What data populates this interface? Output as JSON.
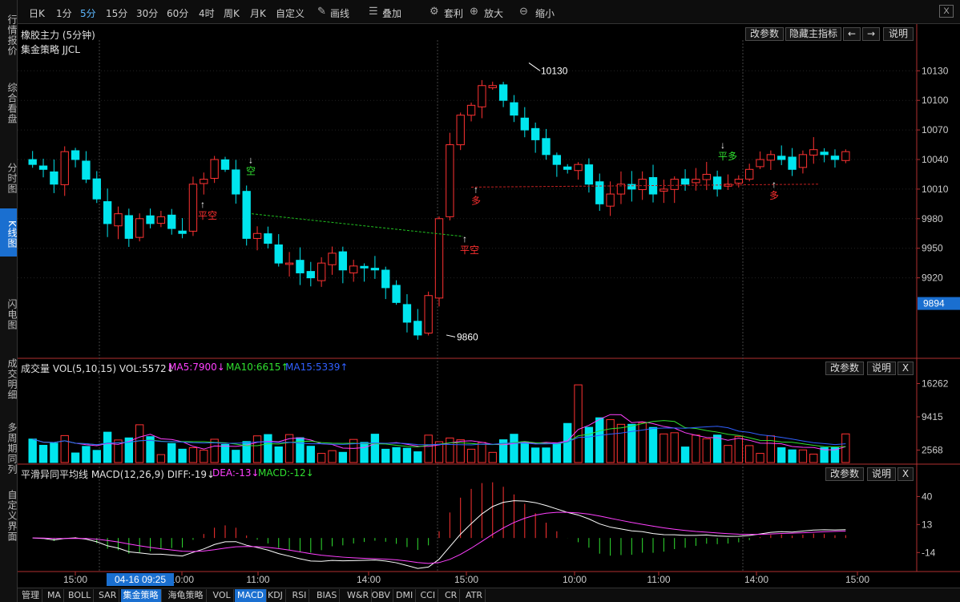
{
  "sidebar": [
    {
      "label": "行情报价",
      "active": false
    },
    {
      "label": "综合看盘",
      "active": false
    },
    {
      "label": "分时图",
      "active": false
    },
    {
      "label": "K线图",
      "active": true
    },
    {
      "label": "闪电图",
      "active": false
    },
    {
      "label": "成交明细",
      "active": false
    },
    {
      "label": "多周期同列",
      "active": false
    },
    {
      "label": "自定义界面",
      "active": false
    }
  ],
  "toolbar": {
    "periods": [
      "日K",
      "1分",
      "5分",
      "15分",
      "30分",
      "60分",
      "4时",
      "周K",
      "月K",
      "自定义"
    ],
    "active_period": "5分",
    "draw_label": "画线",
    "overlay_label": "叠加",
    "arb_label": "套利",
    "zoom_in_label": "放大",
    "zoom_out_label": "缩小",
    "close_label": "X"
  },
  "main": {
    "title": "橡胶主力 (5分钟)",
    "strategy": "集金策略 JJCL",
    "buttons": [
      "改参数",
      "隐藏主指标",
      "←",
      "→",
      "说明"
    ],
    "high_label": "10130",
    "low_label": "9860",
    "last_price": "9894",
    "yticks": [
      "10130",
      "10100",
      "10070",
      "10040",
      "10010",
      "9980",
      "9950",
      "9920"
    ],
    "signals": [
      {
        "text": "平空",
        "color": "#ff3030"
      },
      {
        "text": "空",
        "color": "#30e030"
      },
      {
        "text": "多",
        "color": "#ff3030"
      },
      {
        "text": "平空",
        "color": "#ff3030"
      },
      {
        "text": "平多",
        "color": "#30e030"
      },
      {
        "text": "多",
        "color": "#ff3030"
      }
    ]
  },
  "volume": {
    "label": "成交量 VOL(5,10,15) VOL:5572↓",
    "ma5": "MA5:7900↓",
    "ma10": "MA10:6615↑",
    "ma15": "MA15:5339↑",
    "buttons": [
      "改参数",
      "说明",
      "X"
    ],
    "yticks": [
      "16262",
      "9415",
      "2568"
    ]
  },
  "macd": {
    "label": "平滑异同平均线 MACD(12,26,9) DIFF:-19↓",
    "dea": "DEA:-13↓",
    "macd": "MACD:-12↓",
    "buttons": [
      "改参数",
      "说明",
      "X"
    ],
    "yticks": [
      "40",
      "13",
      "-14"
    ]
  },
  "xaxis": {
    "labels": [
      "15:00",
      "10:00",
      "11:00",
      "14:00",
      "15:00",
      "10:00",
      "11:00",
      "14:00",
      "15:00"
    ],
    "cursor_time": "04-16 09:25"
  },
  "bottom_tabs": {
    "items": [
      "管理",
      "MA",
      "BOLL",
      "SAR",
      "集金策略",
      "海龟策略",
      "VOL",
      "MACD",
      "KDJ",
      "RSI",
      "BIAS",
      "W&R",
      "OBV",
      "DMI",
      "CCI",
      "CR",
      "ATR"
    ],
    "active": [
      "集金策略",
      "MACD"
    ]
  },
  "colors": {
    "up": "#ff3232",
    "down": "#00e5ee",
    "accent": "#1a6fd0"
  }
}
